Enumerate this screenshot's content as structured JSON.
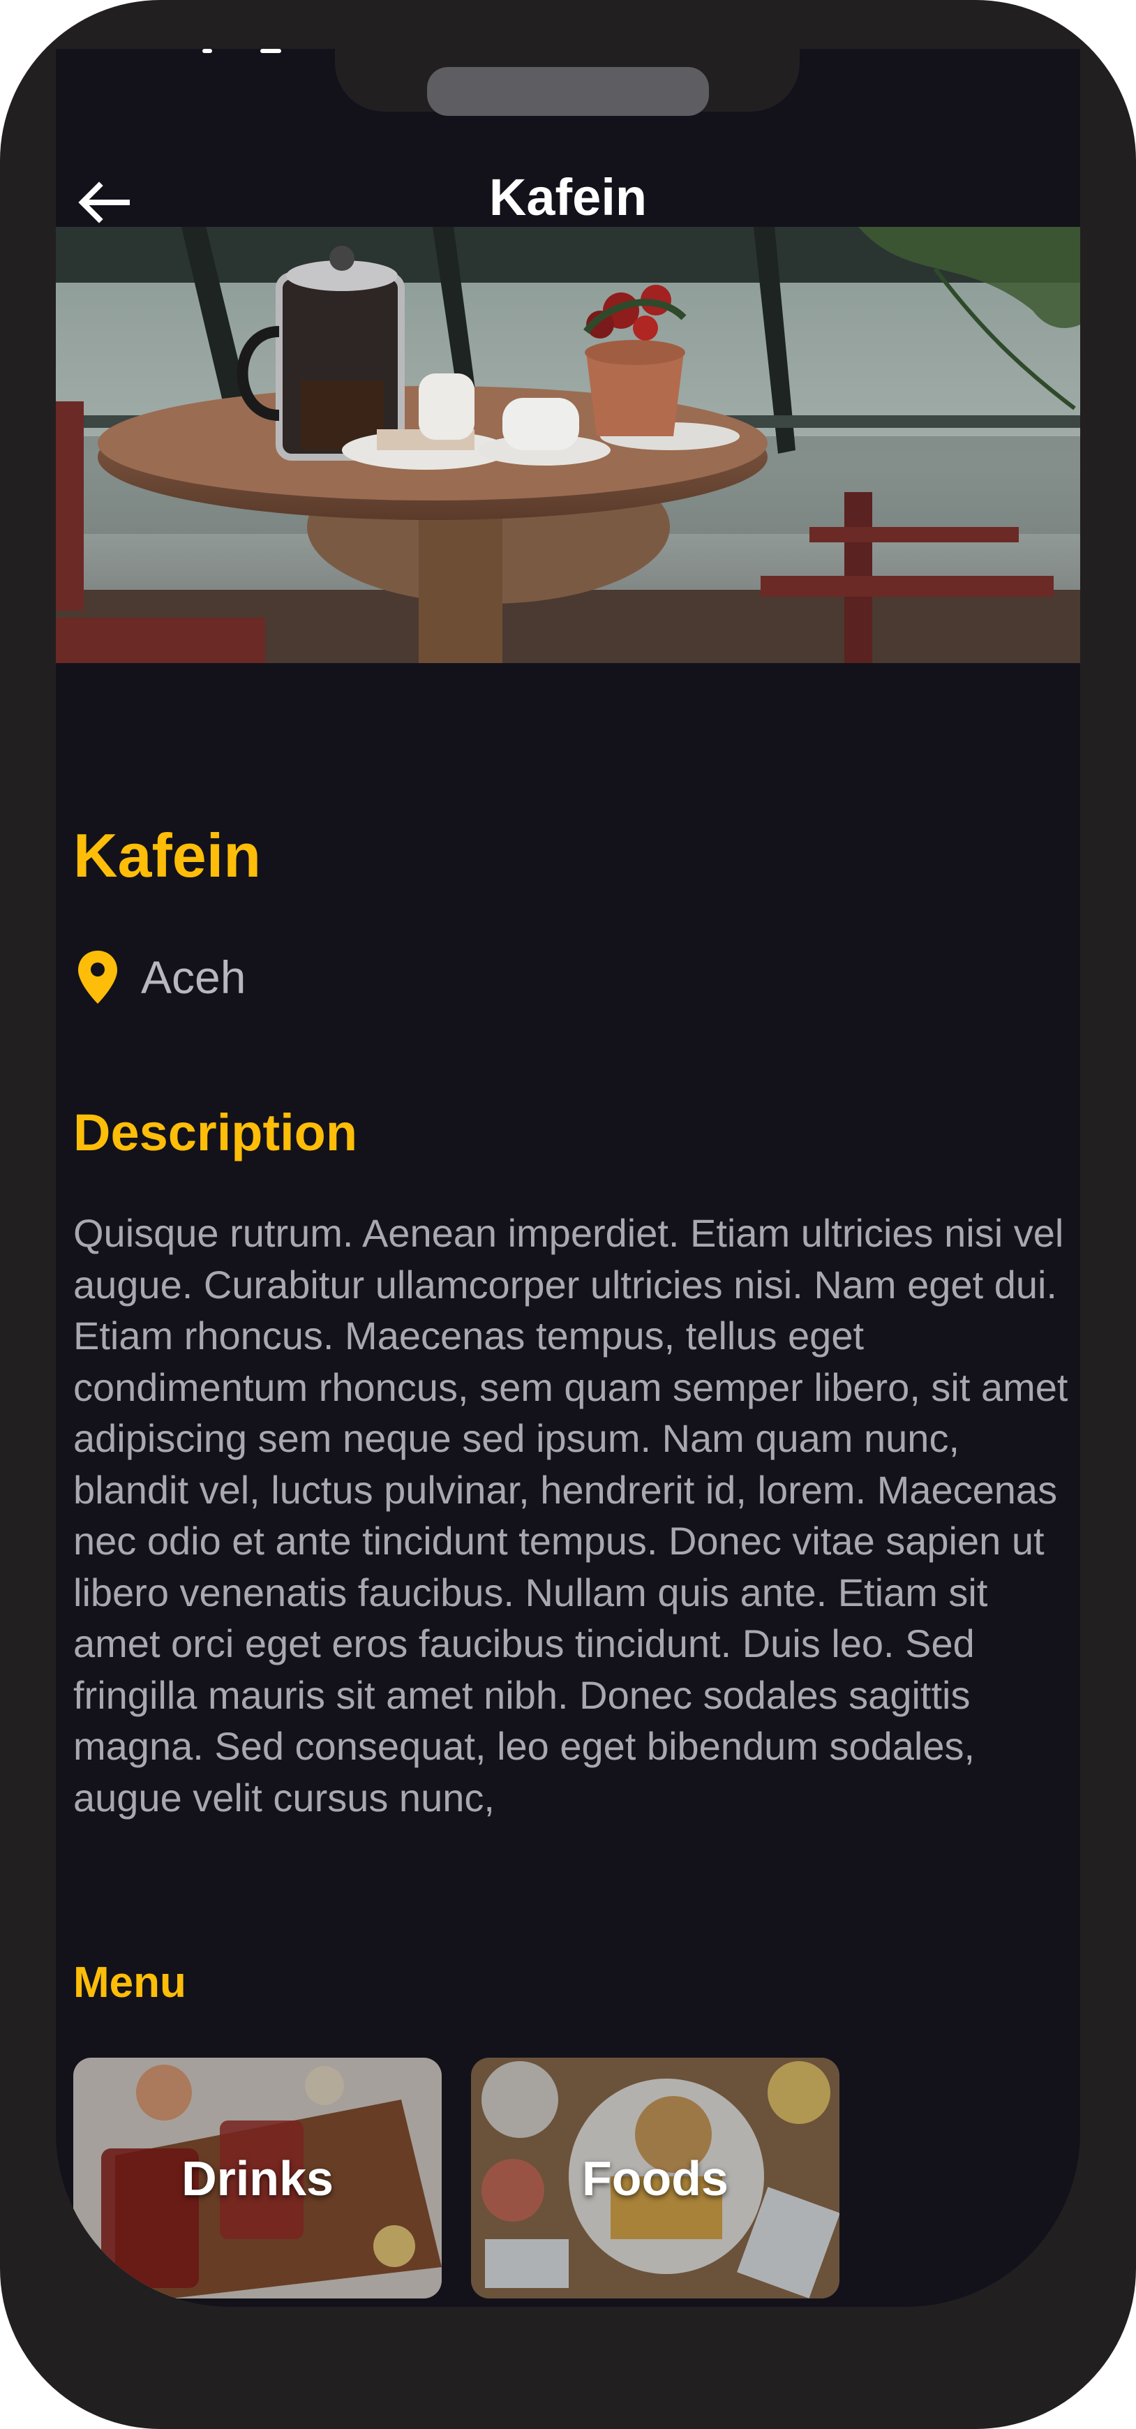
{
  "app_bar": {
    "title": "Kafein",
    "back_icon": "arrow-left-icon"
  },
  "place": {
    "name": "Kafein",
    "location": "Aceh",
    "location_icon": "map-pin-icon",
    "hero_image": "cafe-table-photo"
  },
  "description": {
    "title": "Description",
    "text": "Quisque rutrum. Aenean imperdiet. Etiam ultricies nisi vel augue. Curabitur ullamcorper ultricies nisi. Nam eget dui. Etiam rhoncus. Maecenas tempus, tellus eget condimentum rhoncus, sem quam semper libero, sit amet adipiscing sem neque sed ipsum. Nam quam nunc, blandit vel, luctus pulvinar, hendrerit id, lorem. Maecenas nec odio et ante tincidunt tempus. Donec vitae sapien ut libero venenatis faucibus. Nullam quis ante. Etiam sit amet orci eget eros faucibus tincidunt. Duis leo. Sed fringilla mauris sit amet nibh. Donec sodales sagittis magna. Sed consequat, leo eget bibendum sodales, augue velit cursus nunc,"
  },
  "menu": {
    "title": "Menu",
    "items": [
      {
        "label": "Drinks",
        "image": "drinks-photo"
      },
      {
        "label": "Foods",
        "image": "foods-photo"
      }
    ]
  },
  "colors": {
    "accent": "#fdbd08",
    "background": "#13121b",
    "frame": "#221f21",
    "body_text": "#a9a8af"
  }
}
